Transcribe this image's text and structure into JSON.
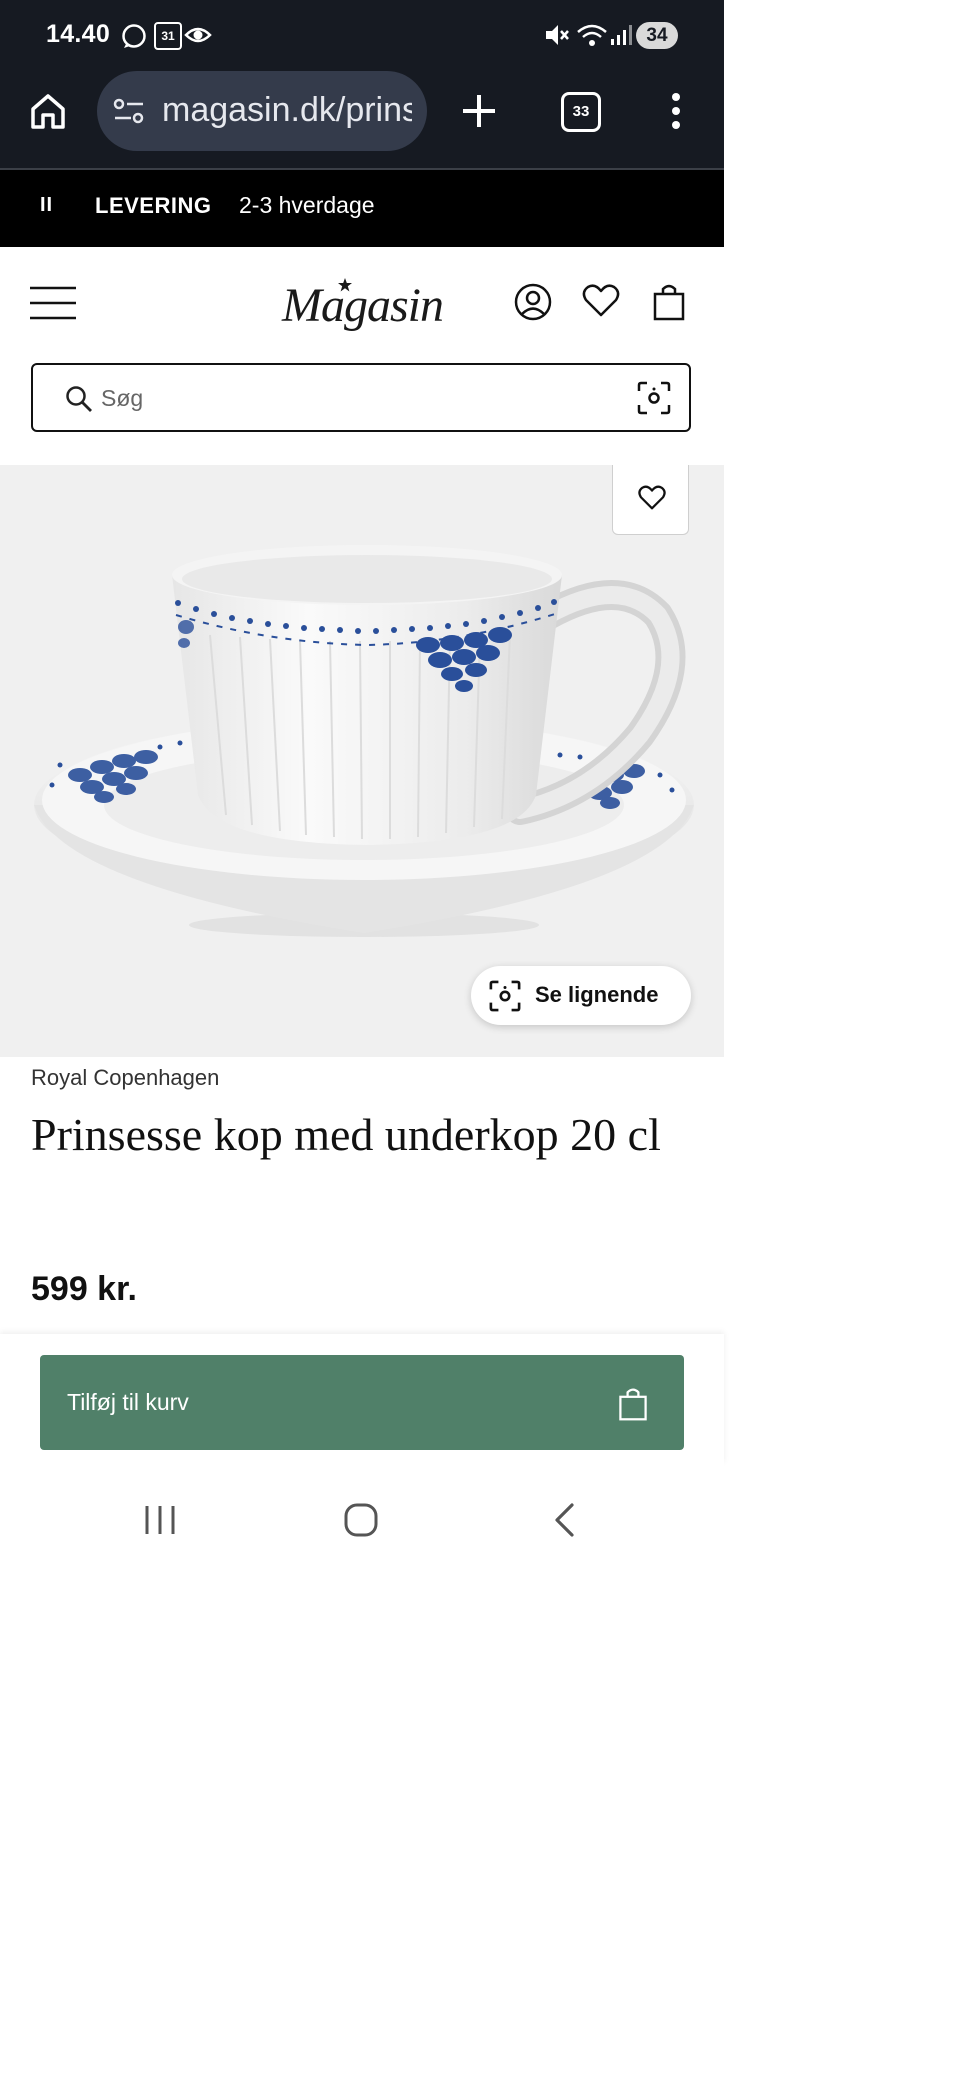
{
  "status_bar": {
    "time": "14.40",
    "calendar_day": "31",
    "battery": "34",
    "icons": [
      "chat-bubble-icon",
      "calendar-icon",
      "eye-icon",
      "mute-icon",
      "wifi-icon",
      "signal-icon",
      "battery-icon"
    ]
  },
  "browser": {
    "url": "magasin.dk/prinsesse-kop-med-underkop",
    "tab_count": "33",
    "icons": [
      "home-icon",
      "site-settings-icon",
      "new-tab-icon",
      "tabs-icon",
      "more-menu-icon"
    ]
  },
  "banner": {
    "pause_label": "II",
    "label": "LEVERING",
    "text": "2-3 hverdage"
  },
  "header": {
    "logo": "Magasin",
    "icons": [
      "menu-icon",
      "account-icon",
      "heart-icon",
      "bag-icon"
    ]
  },
  "search": {
    "placeholder": "Søg"
  },
  "product": {
    "see_similar_label": "Se lignende",
    "brand": "Royal Copenhagen",
    "title": "Prinsesse kop med underkop 20 cl",
    "price": "599 kr.",
    "add_to_cart_label": "Tilføj til kurv",
    "accent_color": "#508069",
    "pattern_color": "#2a4f9a"
  },
  "system_nav": {
    "icons": [
      "recent-apps-icon",
      "home-button-icon",
      "back-icon"
    ]
  }
}
